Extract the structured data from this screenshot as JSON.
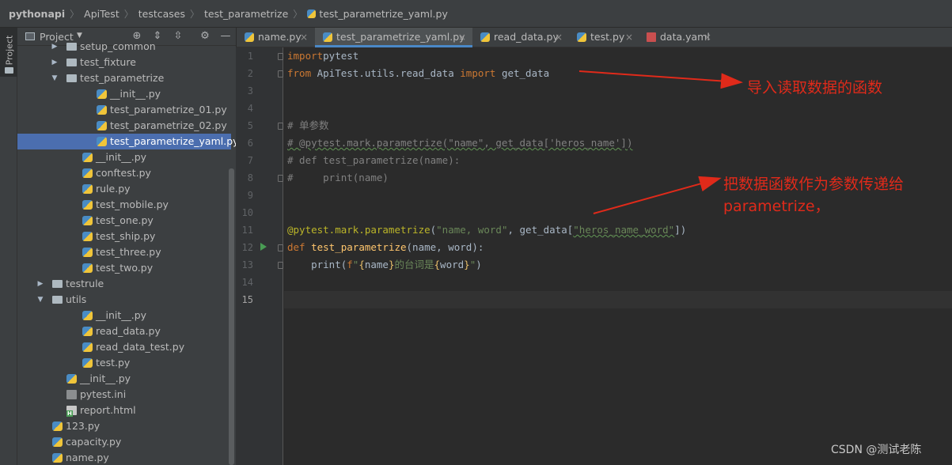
{
  "breadcrumb": [
    "pythonapi",
    "ApiTest",
    "testcases",
    "test_parametrize",
    "test_parametrize_yaml.py"
  ],
  "sidebar_strip": {
    "label": "Project"
  },
  "project_panel": {
    "title": "Project"
  },
  "tree": [
    {
      "label": "setup_common",
      "type": "folder",
      "expanded": false
    },
    {
      "label": "test_fixture",
      "type": "folder",
      "expanded": false
    },
    {
      "label": "test_parametrize",
      "type": "folder",
      "expanded": true
    },
    {
      "label": "__init__.py",
      "type": "py"
    },
    {
      "label": "test_parametrize_01.py",
      "type": "py"
    },
    {
      "label": "test_parametrize_02.py",
      "type": "py"
    },
    {
      "label": "test_parametrize_yaml.py",
      "type": "py",
      "selected": true
    },
    {
      "label": "__init__.py",
      "type": "py"
    },
    {
      "label": "conftest.py",
      "type": "py"
    },
    {
      "label": "rule.py",
      "type": "py"
    },
    {
      "label": "test_mobile.py",
      "type": "py"
    },
    {
      "label": "test_one.py",
      "type": "py"
    },
    {
      "label": "test_ship.py",
      "type": "py"
    },
    {
      "label": "test_three.py",
      "type": "py"
    },
    {
      "label": "test_two.py",
      "type": "py"
    },
    {
      "label": "testrule",
      "type": "folder",
      "expanded": false
    },
    {
      "label": "utils",
      "type": "folder",
      "expanded": true
    },
    {
      "label": "__init__.py",
      "type": "py"
    },
    {
      "label": "read_data.py",
      "type": "py"
    },
    {
      "label": "read_data_test.py",
      "type": "py"
    },
    {
      "label": "test.py",
      "type": "py"
    },
    {
      "label": "__init__.py",
      "type": "py"
    },
    {
      "label": "pytest.ini",
      "type": "ini"
    },
    {
      "label": "report.html",
      "type": "html"
    },
    {
      "label": "123.py",
      "type": "py"
    },
    {
      "label": "capacity.py",
      "type": "py"
    },
    {
      "label": "name.py",
      "type": "py"
    }
  ],
  "tabs": [
    {
      "label": "name.py",
      "icon": "python-file-icon"
    },
    {
      "label": "test_parametrize_yaml.py",
      "icon": "python-file-icon",
      "active": true
    },
    {
      "label": "read_data.py",
      "icon": "python-file-icon"
    },
    {
      "label": "test.py",
      "icon": "python-file-icon"
    },
    {
      "label": "data.yaml",
      "icon": "yaml-file-icon"
    }
  ],
  "editor": {
    "line_numbers": [
      "1",
      "2",
      "3",
      "4",
      "5",
      "6",
      "7",
      "8",
      "9",
      "10",
      "11",
      "12",
      "13",
      "14",
      "15"
    ],
    "current_line": "15",
    "lines": [
      [
        [
          "kw",
          "import"
        ],
        [
          "",
          "pytest"
        ]
      ],
      [
        [
          "kw",
          "from"
        ],
        [
          "",
          " ApiTest.utils.read_data "
        ],
        [
          "kw",
          "import"
        ],
        [
          "",
          " get_data"
        ]
      ],
      [],
      [],
      [
        [
          "cm",
          "# 单参数"
        ]
      ],
      [
        [
          "cm",
          "# @pytest.mark.parametrize(\"name\", get_data['heros_name'])"
        ]
      ],
      [
        [
          "cm",
          "# def test_parametrize(name):"
        ]
      ],
      [
        [
          "cm",
          "#     print(name)"
        ]
      ],
      [],
      [],
      [
        [
          "dec",
          "@pytest.mark.parametrize"
        ],
        [
          "",
          "("
        ],
        [
          "st",
          "\"name, word\""
        ],
        [
          "",
          ", get_data["
        ],
        [
          "st",
          "\"heros_name_word\""
        ],
        [
          "",
          "])"
        ]
      ],
      [
        [
          "kw",
          "def"
        ],
        [
          "",
          " "
        ],
        [
          "fn",
          "test_parametrize"
        ],
        [
          "",
          "(name, word):"
        ]
      ],
      [
        [
          "",
          "    print("
        ],
        [
          "kw",
          "f"
        ],
        [
          "st",
          "\""
        ],
        [
          "br",
          "{"
        ],
        [
          "",
          "name"
        ],
        [
          "br",
          "}"
        ],
        [
          "st",
          "的台词是"
        ],
        [
          "br",
          "{"
        ],
        [
          "",
          "word"
        ],
        [
          "br",
          "}"
        ],
        [
          "st",
          "\""
        ],
        [
          "",
          ")"
        ]
      ],
      [],
      []
    ]
  },
  "annotations": {
    "first": "导入读取数据的函数",
    "second_line1": "把数据函数作为参数传递给",
    "second_line2": "parametrize，"
  },
  "watermark": "CSDN @测试老陈",
  "colors": {
    "annotation": "#e02a1a",
    "selection": "#4b6eaf",
    "keyword": "#cc7832",
    "string": "#6a8759",
    "decorator": "#bbb529"
  }
}
